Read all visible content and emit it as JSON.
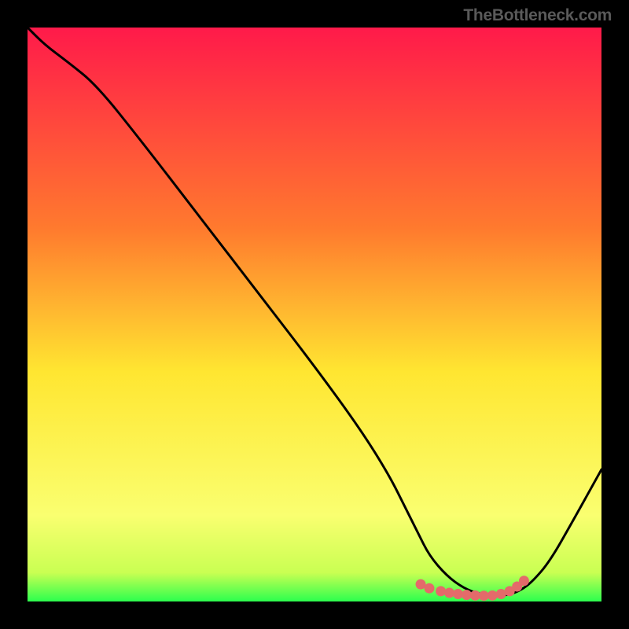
{
  "attribution": "TheBottleneck.com",
  "chart_data": {
    "type": "line",
    "title": "",
    "xlabel": "",
    "ylabel": "",
    "xlim": [
      0,
      100
    ],
    "ylim": [
      0,
      100
    ],
    "gradient_stops": [
      {
        "offset": 0,
        "color": "#ff1a4a"
      },
      {
        "offset": 35,
        "color": "#ff7a2e"
      },
      {
        "offset": 60,
        "color": "#ffe631"
      },
      {
        "offset": 85,
        "color": "#faff70"
      },
      {
        "offset": 95,
        "color": "#c9ff52"
      },
      {
        "offset": 100,
        "color": "#2cff4e"
      }
    ],
    "series": [
      {
        "name": "bottleneck-curve",
        "x": [
          0,
          3,
          7,
          12,
          20,
          30,
          40,
          50,
          58,
          63,
          66,
          68,
          70,
          73,
          76,
          79,
          82,
          84,
          86,
          88,
          91,
          95,
          100
        ],
        "y": [
          100,
          97,
          94,
          90,
          80,
          67,
          54,
          41,
          30,
          22,
          16,
          12,
          8,
          4.5,
          2.3,
          1.2,
          1.0,
          1.2,
          2.0,
          3.5,
          7,
          14,
          23
        ]
      }
    ],
    "highlight_dots": {
      "name": "optimal-region",
      "color": "#e46a6a",
      "points": [
        {
          "x": 68.5,
          "y": 3.0
        },
        {
          "x": 70,
          "y": 2.3
        },
        {
          "x": 72,
          "y": 1.8
        },
        {
          "x": 73.5,
          "y": 1.5
        },
        {
          "x": 75,
          "y": 1.3
        },
        {
          "x": 76.5,
          "y": 1.15
        },
        {
          "x": 78,
          "y": 1.05
        },
        {
          "x": 79.5,
          "y": 1.0
        },
        {
          "x": 81,
          "y": 1.05
        },
        {
          "x": 82.5,
          "y": 1.3
        },
        {
          "x": 84,
          "y": 1.8
        },
        {
          "x": 85.3,
          "y": 2.6
        },
        {
          "x": 86.5,
          "y": 3.6
        }
      ]
    }
  }
}
